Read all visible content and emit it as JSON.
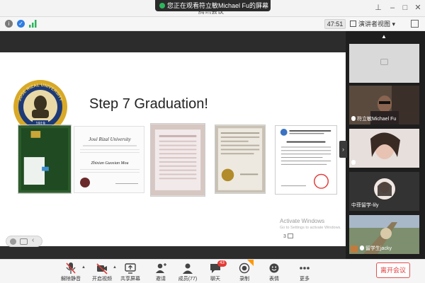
{
  "window": {
    "title": "腾讯会议",
    "share_banner": "您正在观看符立敏Michael Fu的屏幕",
    "share_more": "···"
  },
  "infobar": {
    "timer": "47:51",
    "view_label": "演讲者视图"
  },
  "slide": {
    "seal_text": "JOSE RIZAL UNIVERSITY",
    "seal_year": "1919",
    "title": "Step 7   Graduation!",
    "diploma_header": "José Rizal University",
    "diploma_name": "Zhixian Guoxian Mou",
    "watermark_line1": "Activate Windows",
    "watermark_line2": "Go to Settings to activate Windows.",
    "page_label": "3"
  },
  "participants": [
    {
      "name": "",
      "state": "camera-off"
    },
    {
      "name": "符立敏Michael Fu",
      "state": "video"
    },
    {
      "name": "",
      "state": "video"
    },
    {
      "name": "中菲留学-lily",
      "state": "avatar"
    },
    {
      "name": "留学生jacky",
      "state": "video"
    }
  ],
  "toolbar": {
    "items": [
      {
        "label": "解除静音",
        "icon": "mic-muted-icon"
      },
      {
        "label": "开启视频",
        "icon": "camera-off-icon"
      },
      {
        "label": "共享屏幕",
        "icon": "share-screen-icon"
      },
      {
        "label": "邀请",
        "icon": "invite-icon"
      },
      {
        "label": "成员(77)",
        "icon": "members-icon"
      },
      {
        "label": "聊天",
        "icon": "chat-icon",
        "badge": "43"
      },
      {
        "label": "录制",
        "icon": "record-icon"
      },
      {
        "label": "表情",
        "icon": "emoji-icon"
      },
      {
        "label": "更多",
        "icon": "more-icon"
      }
    ],
    "leave_label": "离开会议"
  },
  "colors": {
    "accent_red": "#e03c3c",
    "share_dot": "#2db55d",
    "seal_gold": "#d8a928",
    "seal_blue": "#1d3a78"
  }
}
